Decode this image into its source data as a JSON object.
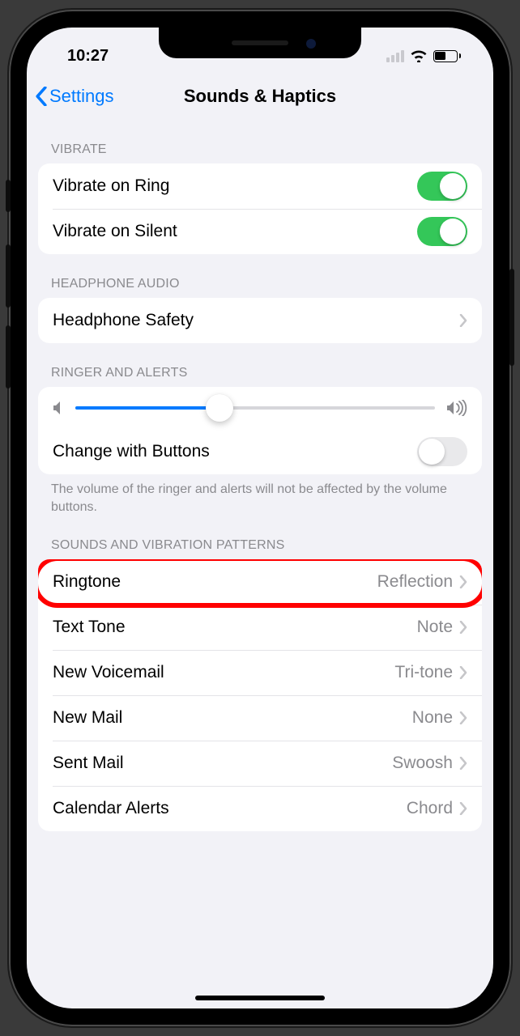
{
  "status": {
    "time": "10:27"
  },
  "nav": {
    "back_label": "Settings",
    "title": "Sounds & Haptics"
  },
  "sections": {
    "vibrate": {
      "header": "VIBRATE",
      "ring_label": "Vibrate on Ring",
      "ring_on": true,
      "silent_label": "Vibrate on Silent",
      "silent_on": true
    },
    "headphone": {
      "header": "HEADPHONE AUDIO",
      "safety_label": "Headphone Safety"
    },
    "ringer": {
      "header": "RINGER AND ALERTS",
      "slider_percent": 40,
      "change_buttons_label": "Change with Buttons",
      "change_buttons_on": false,
      "footer": "The volume of the ringer and alerts will not be affected by the volume buttons."
    },
    "patterns": {
      "header": "SOUNDS AND VIBRATION PATTERNS",
      "items": [
        {
          "label": "Ringtone",
          "value": "Reflection",
          "highlighted": true
        },
        {
          "label": "Text Tone",
          "value": "Note"
        },
        {
          "label": "New Voicemail",
          "value": "Tri-tone"
        },
        {
          "label": "New Mail",
          "value": "None"
        },
        {
          "label": "Sent Mail",
          "value": "Swoosh"
        },
        {
          "label": "Calendar Alerts",
          "value": "Chord"
        }
      ]
    }
  }
}
